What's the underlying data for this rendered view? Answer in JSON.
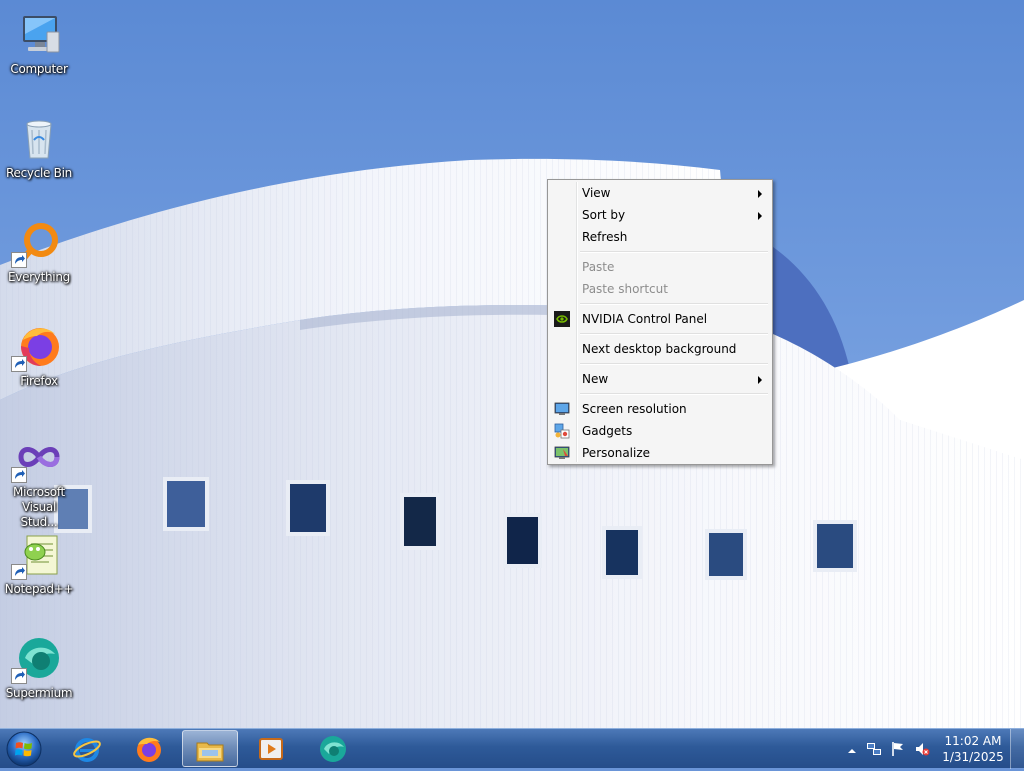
{
  "desktop": {
    "icons": [
      {
        "label": "Computer",
        "icon": "computer-icon"
      },
      {
        "label": "Recycle Bin",
        "icon": "recycle-bin-icon"
      },
      {
        "label": "Everything",
        "icon": "everything-icon",
        "shortcut": true
      },
      {
        "label": "Firefox",
        "icon": "firefox-icon",
        "shortcut": true
      },
      {
        "label": "Microsoft Visual Stud...",
        "icon": "visual-studio-icon",
        "shortcut": true
      },
      {
        "label": "Notepad++",
        "icon": "notepadpp-icon",
        "shortcut": true
      },
      {
        "label": "Supermium",
        "icon": "supermium-icon",
        "shortcut": true
      }
    ]
  },
  "context_menu": {
    "view": "View",
    "sort_by": "Sort by",
    "refresh": "Refresh",
    "paste": "Paste",
    "paste_shortcut": "Paste shortcut",
    "nvidia": "NVIDIA Control Panel",
    "next_background": "Next desktop background",
    "new": "New",
    "screen_resolution": "Screen resolution",
    "gadgets": "Gadgets",
    "personalize": "Personalize"
  },
  "taskbar": {
    "pinned": [
      "internet-explorer-icon",
      "firefox-icon",
      "file-explorer-icon",
      "media-player-icon",
      "supermium-icon"
    ],
    "clock": {
      "time": "11:02 AM",
      "date": "1/31/2025"
    }
  },
  "colors": {
    "sky": "#6a95d8",
    "taskbar": "#2e5a99",
    "menu_bg": "#f5f5f5"
  }
}
